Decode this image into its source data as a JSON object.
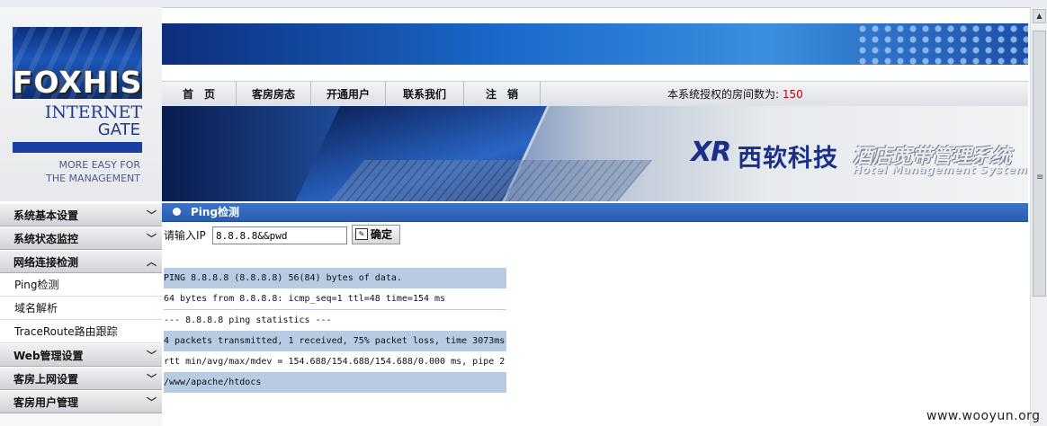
{
  "logo": {
    "brand": "FOXHIS",
    "line1": "INTERNET",
    "line2": "GATE",
    "tagline1": "MORE EASY FOR",
    "tagline2": "THE MANAGEMENT"
  },
  "nav": {
    "items": [
      "首　页",
      "客房房态",
      "开通用户",
      "联系我们",
      "注　销"
    ],
    "status_label": "本系统授权的房间数为:",
    "room_count": "150"
  },
  "hero": {
    "company_logo": "XR",
    "company_name": "西软科技",
    "system_name": "酒店宽带管理系统",
    "system_name_en": "Hotel Management System"
  },
  "sidebar": {
    "menus": [
      {
        "label": "系统基本设置",
        "expanded": false
      },
      {
        "label": "系统状态监控",
        "expanded": false
      },
      {
        "label": "网络连接检测",
        "expanded": true,
        "items": [
          "Ping检测",
          "域名解析",
          "TraceRoute路由跟踪"
        ]
      },
      {
        "label": "Web管理设置",
        "expanded": false
      },
      {
        "label": "客房上网设置",
        "expanded": false
      },
      {
        "label": "客房用户管理",
        "expanded": false
      }
    ]
  },
  "content": {
    "section_title": "Ping检测",
    "ip_label": "请输入IP",
    "ip_value": "8.8.8.8&&pwd",
    "ok_button": "确定",
    "output_lines": [
      "PING 8.8.8.8 (8.8.8.8) 56(84) bytes of data.",
      "64 bytes from 8.8.8.8: icmp_seq=1 ttl=48 time=154 ms",
      "--- 8.8.8.8 ping statistics ---",
      "4 packets transmitted, 1 received, 75% packet loss, time 3073ms",
      "rtt min/avg/max/mdev = 154.688/154.688/154.688/0.000 ms, pipe 2",
      "/www/apache/htdocs"
    ]
  },
  "watermark": "www.wooyun.org",
  "colors": {
    "section_bar": "#2b5db0",
    "highlight_row": "#b8cbe3",
    "room_count": "#cc0000",
    "brand_blue": "#1a2f8a"
  },
  "icons": {
    "menu_collapsed": "chevron-down-icon",
    "menu_expanded": "chevron-up-icon",
    "section_bullet": "bullet-dot-icon",
    "ok_button": "edit-icon"
  }
}
